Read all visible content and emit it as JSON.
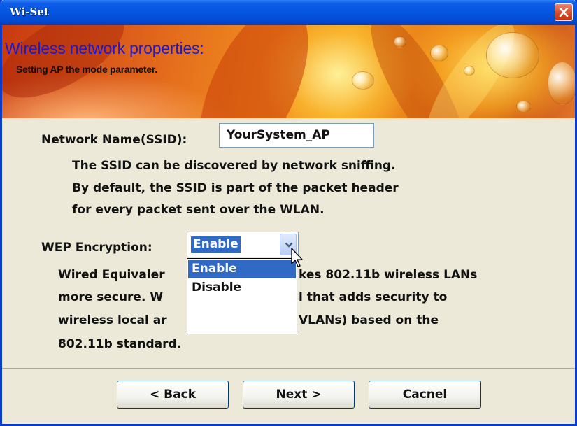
{
  "window": {
    "title": "Wi-Set"
  },
  "banner": {
    "title": "Wireless network properties:",
    "subtitle": "Setting AP the mode parameter."
  },
  "ssid": {
    "label": "Network Name(SSID):",
    "value": "YourSystem_AP",
    "description": [
      "The SSID can be discovered by network sniffing.",
      "By default, the SSID is part of the packet header",
      "for every packet sent over the WLAN."
    ]
  },
  "wep": {
    "label": "WEP Encryption:",
    "selected": "Enable",
    "options": [
      "Enable",
      "Disable"
    ],
    "description": [
      "Wired Equivaler",
      "kes 802.11b wireless LANs",
      "more secure. W",
      "l that adds security to",
      "wireless local ar",
      "VLANs) based on the",
      "802.11b standard."
    ]
  },
  "buttons": {
    "back": {
      "prefix": "< ",
      "mnemonic": "B",
      "rest": "ack"
    },
    "next": {
      "mnemonic": "N",
      "rest": "ext >"
    },
    "cancel": {
      "mnemonic": "C",
      "rest": "acnel"
    }
  },
  "icons": {
    "close": "close-icon",
    "dropdown": "chevron-down-icon",
    "cursor": "mouse-pointer-icon"
  },
  "colors": {
    "titlebar": "#0455e0",
    "selection": "#316ac5",
    "banner_title": "#1a1ad6"
  }
}
